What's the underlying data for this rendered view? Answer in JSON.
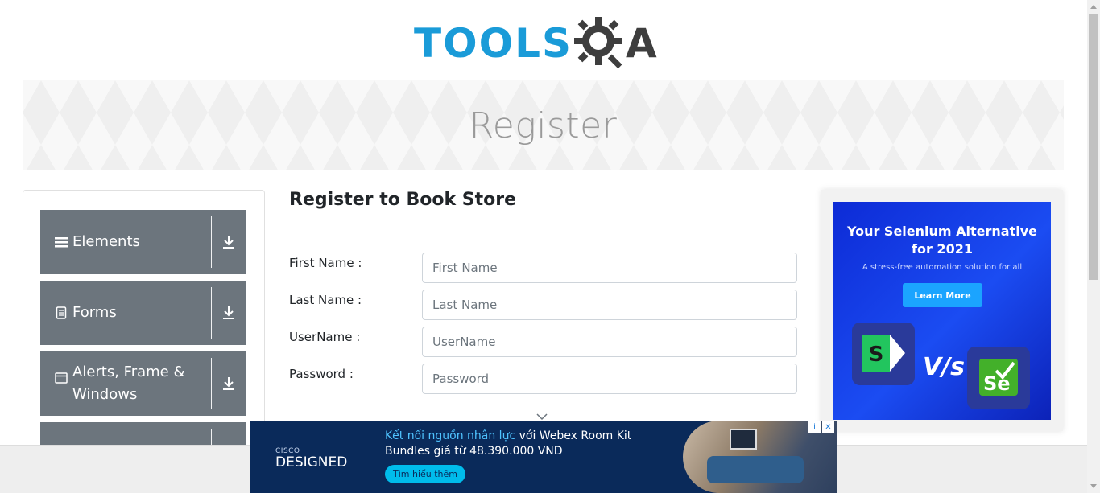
{
  "logo": {
    "tools": "TOOLS",
    "qa": "A"
  },
  "banner": {
    "title": "Register"
  },
  "sidebar": {
    "groups": [
      {
        "label": "Elements",
        "icon": "hamburger-icon"
      },
      {
        "label": "Forms",
        "icon": "document-icon"
      },
      {
        "label": "Alerts, Frame & Windows",
        "icon": "window-icon"
      },
      {
        "label": "",
        "icon": "download-icon"
      }
    ]
  },
  "form": {
    "title": "Register to Book Store",
    "first_name_label": "First Name :",
    "first_name_placeholder": "First Name",
    "last_name_label": "Last Name :",
    "last_name_placeholder": "Last Name",
    "username_label": "UserName :",
    "username_placeholder": "UserName",
    "password_label": "Password :",
    "password_placeholder": "Password"
  },
  "right_ad": {
    "title_line1": "Your Selenium Alternative",
    "title_line2": "for 2021",
    "subtitle": "A stress-free automation solution for all",
    "cta": "Learn More",
    "vs": "V/s",
    "tile_right": "Se"
  },
  "bottom_ad": {
    "brand_top": "CISCO",
    "brand": "DESIGNED",
    "highlight": "Kết nối nguồn nhân lực",
    "text_rest": " với Webex Room Kit Bundles giá từ 48.390.000 VND",
    "cta": "Tìm hiểu thêm",
    "info": "i",
    "close": "✕"
  },
  "colors": {
    "accent_blue": "#1a9bd8",
    "sidebar_gray": "#6c757d",
    "ad_blue": "#1b4cf2",
    "bottom_ad_navy": "#0a2a5a"
  }
}
